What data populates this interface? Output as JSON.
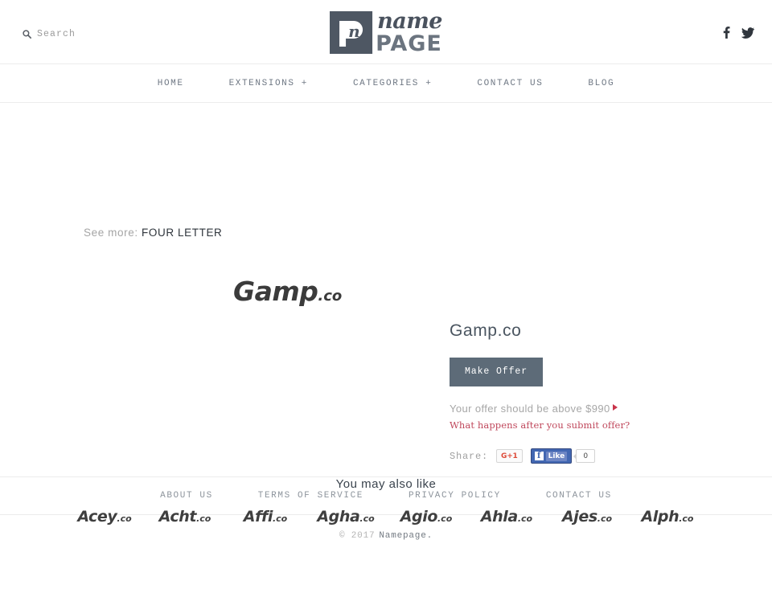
{
  "header": {
    "search": {
      "label": "Search",
      "icon": "search-icon"
    },
    "logo": {
      "mark_letter": "n",
      "script_text": "name",
      "bold_text": "PAGE"
    },
    "social": [
      {
        "name": "facebook-icon",
        "label": "f"
      },
      {
        "name": "twitter-icon",
        "label": "t"
      }
    ]
  },
  "nav": {
    "items": [
      {
        "label": "HOME"
      },
      {
        "label": "EXTENSIONS +"
      },
      {
        "label": "CATEGORIES +"
      },
      {
        "label": "CONTACT US"
      },
      {
        "label": "BLOG"
      }
    ]
  },
  "breadcrumb": {
    "prefix": "See more:",
    "link": "FOUR LETTER"
  },
  "listing": {
    "art_name": "Gamp",
    "art_tld": ".co",
    "title": "Gamp.co",
    "make_offer_label": "Make Offer",
    "offer_note": "Your offer should be above $990",
    "offer_minimum": "$990",
    "offer_faq": "What happens after you submit offer?",
    "share_label": "Share:",
    "gplus_label": "G+1",
    "fb_like_label": "Like",
    "fb_f_label": "f",
    "fb_count": "0",
    "accent_button_color": "#5d6b78",
    "accent_red": "#c0485c"
  },
  "also_like": {
    "title": "You may also like",
    "items": [
      {
        "name": "Acey",
        "tld": ".co"
      },
      {
        "name": "Acht",
        "tld": ".co"
      },
      {
        "name": "Affi",
        "tld": ".co"
      },
      {
        "name": "Agha",
        "tld": ".co"
      },
      {
        "name": "Agio",
        "tld": ".co"
      },
      {
        "name": "Ahla",
        "tld": ".co"
      },
      {
        "name": "Ajes",
        "tld": ".co"
      },
      {
        "name": "Alph",
        "tld": ".co"
      }
    ]
  },
  "footer": {
    "links": [
      {
        "label": "ABOUT US"
      },
      {
        "label": "TERMS OF SERVICE"
      },
      {
        "label": "PRIVACY POLICY"
      },
      {
        "label": "CONTACT US"
      }
    ],
    "copyright_year": "© 2017",
    "copyright_name": "Namepage."
  }
}
